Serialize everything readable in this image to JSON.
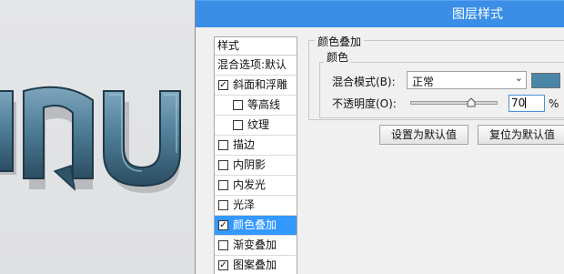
{
  "dialog": {
    "title": "图层样式"
  },
  "style_list": {
    "header": "样式",
    "items": [
      {
        "label": "混合选项:默认",
        "checkbox": false,
        "checked": false,
        "indent": false,
        "selected": false
      },
      {
        "label": "斜面和浮雕",
        "checkbox": true,
        "checked": true,
        "indent": false,
        "selected": false
      },
      {
        "label": "等高线",
        "checkbox": true,
        "checked": false,
        "indent": true,
        "selected": false
      },
      {
        "label": "纹理",
        "checkbox": true,
        "checked": false,
        "indent": true,
        "selected": false
      },
      {
        "label": "描边",
        "checkbox": true,
        "checked": false,
        "indent": false,
        "selected": false
      },
      {
        "label": "内阴影",
        "checkbox": true,
        "checked": false,
        "indent": false,
        "selected": false
      },
      {
        "label": "内发光",
        "checkbox": true,
        "checked": false,
        "indent": false,
        "selected": false
      },
      {
        "label": "光泽",
        "checkbox": true,
        "checked": false,
        "indent": false,
        "selected": false
      },
      {
        "label": "颜色叠加",
        "checkbox": true,
        "checked": true,
        "indent": false,
        "selected": true
      },
      {
        "label": "渐变叠加",
        "checkbox": true,
        "checked": false,
        "indent": false,
        "selected": false
      },
      {
        "label": "图案叠加",
        "checkbox": true,
        "checked": true,
        "indent": false,
        "selected": false
      }
    ]
  },
  "color_overlay": {
    "group_title": "颜色叠加",
    "subgroup_title": "颜色",
    "blend_mode_label": "混合模式(B):",
    "blend_mode_value": "正常",
    "overlay_color": "#4a86a8",
    "opacity_label": "不透明度(O):",
    "opacity_value": "70",
    "opacity_unit": "%",
    "opacity_fraction": 0.7,
    "make_default_button": "设置为默认值",
    "reset_default_button": "复位为默认值"
  },
  "colors": {
    "titlebar": "#3a8ee6",
    "selection": "#3399ff",
    "text_metal": "#4d7d98"
  }
}
